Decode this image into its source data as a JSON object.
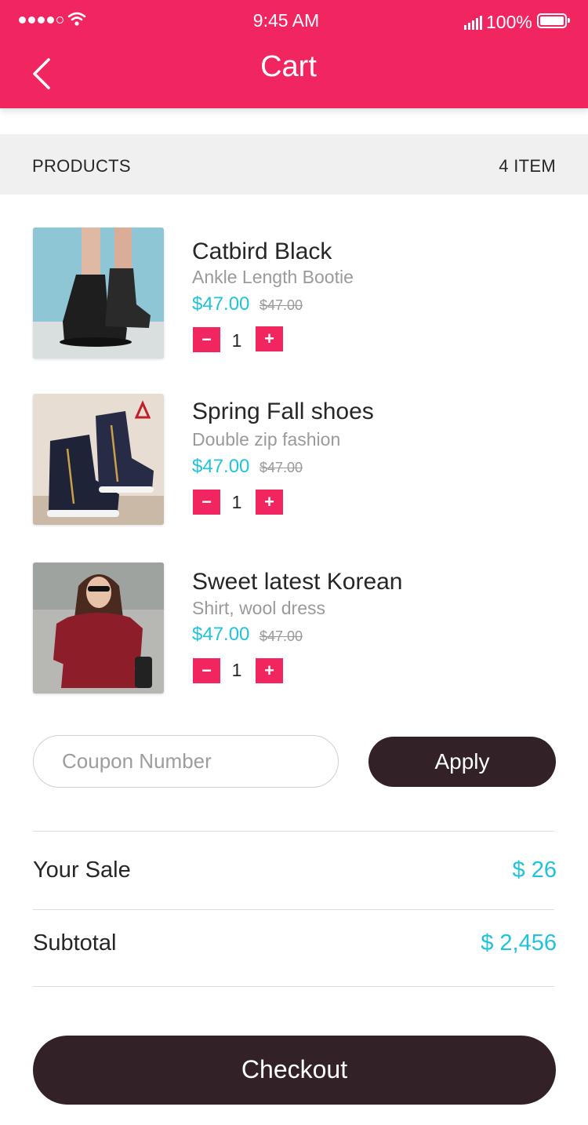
{
  "status_bar": {
    "time": "9:45 AM",
    "battery": "100%"
  },
  "header": {
    "title": "Cart"
  },
  "products_header": {
    "label": "PRODUCTS",
    "count": "4 ITEM"
  },
  "products": [
    {
      "name": "Catbird Black",
      "subtitle": "Ankle Length Bootie",
      "price": "$47.00",
      "old_price": "$47.00",
      "qty": "1",
      "image_icon": "black-ankle-bootie"
    },
    {
      "name": "Spring Fall shoes",
      "subtitle": "Double zip fashion",
      "price": "$47.00",
      "old_price": "$47.00",
      "qty": "1",
      "image_icon": "zip-sneaker"
    },
    {
      "name": "Sweet latest Korean",
      "subtitle": "Shirt, wool dress",
      "price": "$47.00",
      "old_price": "$47.00",
      "qty": "1",
      "image_icon": "woman-red-dress"
    }
  ],
  "qty_controls": {
    "minus": "−",
    "plus": "+"
  },
  "coupon": {
    "placeholder": "Coupon Number",
    "value": "",
    "apply_label": "Apply"
  },
  "summary": {
    "sale_label": "Your Sale",
    "sale_value": "$ 26",
    "subtotal_label": "Subtotal",
    "subtotal_value": "$ 2,456"
  },
  "checkout": {
    "label": "Checkout"
  },
  "colors": {
    "brand": "#f1255f",
    "accent": "#21c2dc",
    "dark": "#322227"
  }
}
